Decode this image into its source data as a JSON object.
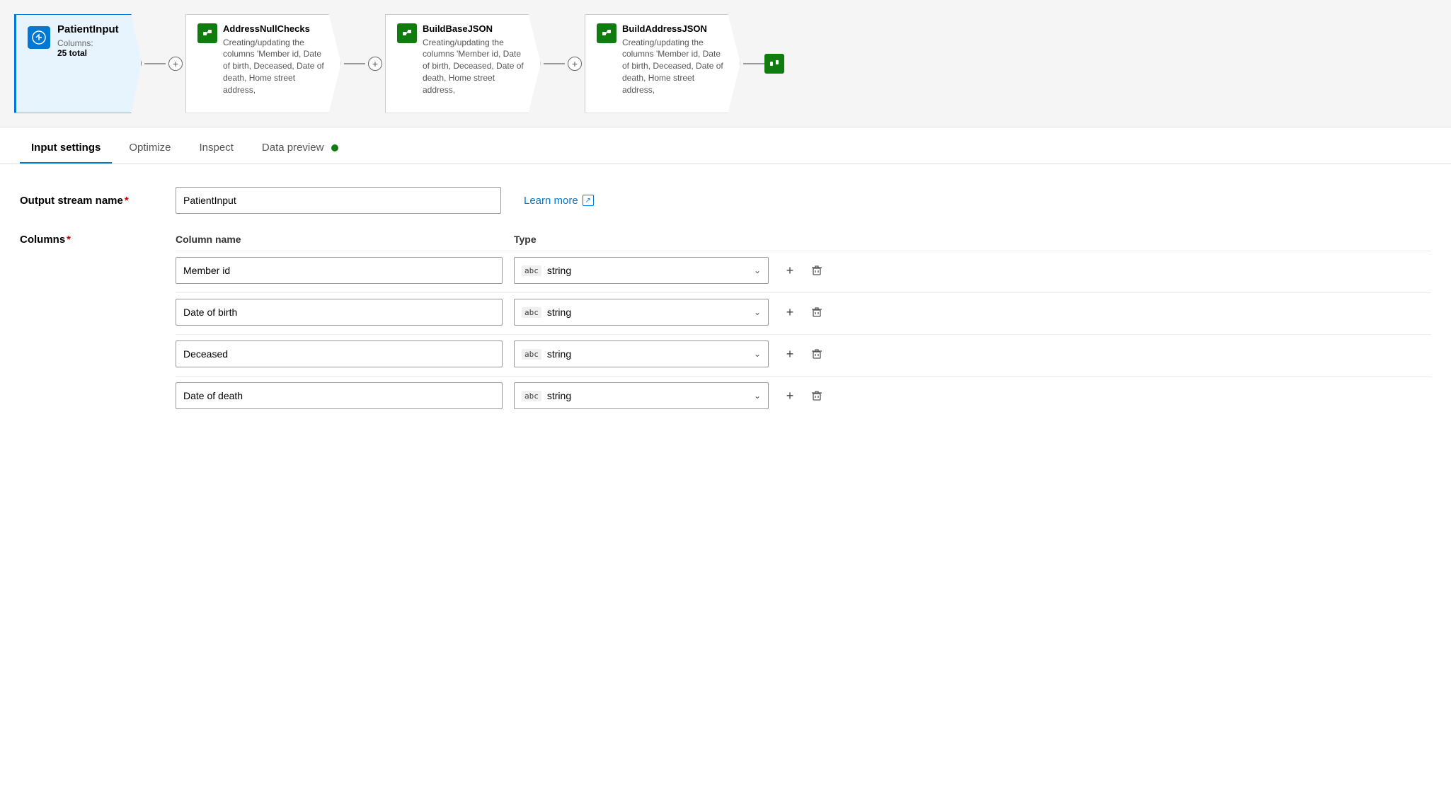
{
  "pipeline": {
    "nodes": [
      {
        "id": "patient-input",
        "title": "PatientInput",
        "subtitle": "Columns:",
        "subtitle_value": "25 total",
        "type": "source",
        "active": true
      },
      {
        "id": "address-null-checks",
        "title": "AddressNullChecks",
        "description": "Creating/updating the columns 'Member id, Date of birth, Deceased, Date of death, Home street address,",
        "type": "transform"
      },
      {
        "id": "build-base-json",
        "title": "BuildBaseJSON",
        "description": "Creating/updating the columns 'Member id, Date of birth, Deceased, Date of death, Home street address,",
        "type": "transform"
      },
      {
        "id": "build-address-json",
        "title": "BuildAddressJSON",
        "description": "Creating/updating the columns 'Member id, Date of birth, Deceased, Date of death, Home street address,",
        "type": "transform"
      }
    ],
    "connector_label": "+"
  },
  "tabs": [
    {
      "id": "input-settings",
      "label": "Input settings",
      "active": true
    },
    {
      "id": "optimize",
      "label": "Optimize",
      "active": false
    },
    {
      "id": "inspect",
      "label": "Inspect",
      "active": false
    },
    {
      "id": "data-preview",
      "label": "Data preview",
      "active": false,
      "has_dot": true
    }
  ],
  "form": {
    "output_stream_name_label": "Output stream name",
    "output_stream_name_value": "PatientInput",
    "required_indicator": "*",
    "learn_more_label": "Learn more",
    "columns_label": "Columns",
    "col_header_name": "Column name",
    "col_header_type": "Type",
    "columns": [
      {
        "id": "col1",
        "name": "Member id",
        "type": "string",
        "type_badge": "abc"
      },
      {
        "id": "col2",
        "name": "Date of birth",
        "type": "string",
        "type_badge": "abc"
      },
      {
        "id": "col3",
        "name": "Deceased",
        "type": "string",
        "type_badge": "abc"
      },
      {
        "id": "col4",
        "name": "Date of death",
        "type": "string",
        "type_badge": "abc"
      }
    ],
    "add_icon": "+",
    "delete_icon": "🗑"
  },
  "colors": {
    "active_tab_underline": "#0078d4",
    "required_star": "#c50000",
    "link": "#0078d4",
    "dot": "#107c10"
  }
}
